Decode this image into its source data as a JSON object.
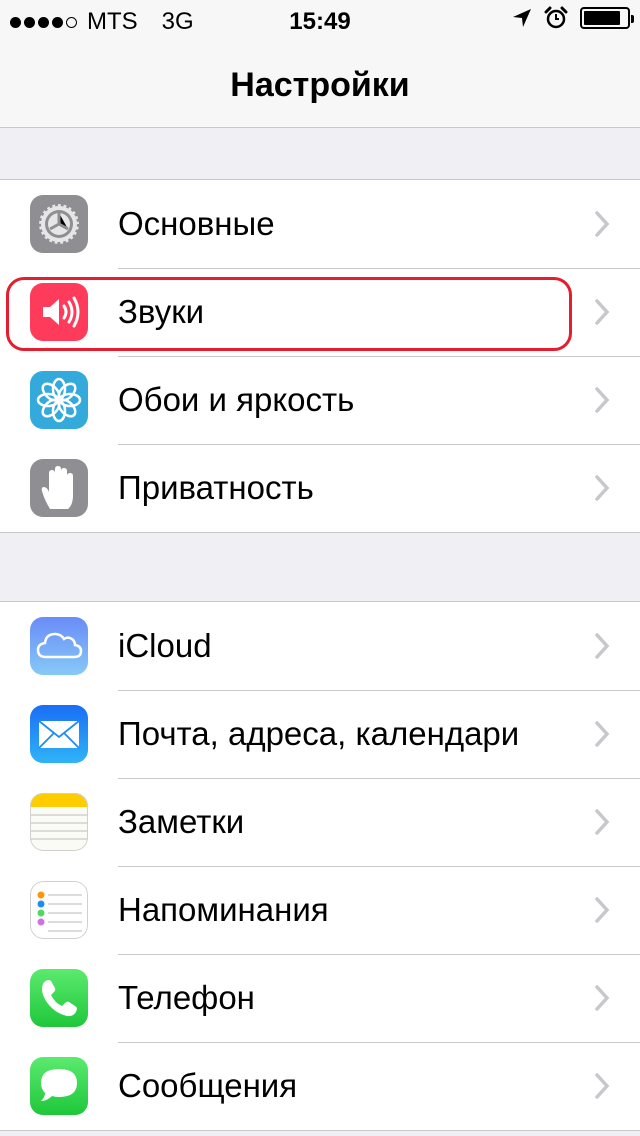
{
  "status_bar": {
    "carrier": "MTS",
    "network": "3G",
    "time": "15:49",
    "signal_bars": 4,
    "battery_level_pct": 85,
    "icons": [
      "location-arrow-icon",
      "alarm-clock-icon",
      "battery-icon"
    ]
  },
  "nav": {
    "title": "Настройки"
  },
  "groups": [
    {
      "items": [
        {
          "label": "Основные",
          "icon": "gear-icon",
          "color": "#8e8e93"
        },
        {
          "label": "Звуки",
          "icon": "speaker-icon",
          "color": "#ff3b5c",
          "highlighted": true
        },
        {
          "label": "Обои и яркость",
          "icon": "flower-icon",
          "color": "#34aadc"
        },
        {
          "label": "Приватность",
          "icon": "hand-icon",
          "color": "#8e8e93"
        }
      ]
    },
    {
      "items": [
        {
          "label": "iCloud",
          "icon": "cloud-icon",
          "color": "#5a7cf5"
        },
        {
          "label": "Почта, адреса, календари",
          "icon": "envelope-icon",
          "color": "#1e8cf5"
        },
        {
          "label": "Заметки",
          "icon": "notepad-icon",
          "color": "#ffcc00"
        },
        {
          "label": "Напоминания",
          "icon": "checklist-icon",
          "color": "#ffffff"
        },
        {
          "label": "Телефон",
          "icon": "phone-icon",
          "color": "#4cd964"
        },
        {
          "label": "Сообщения",
          "icon": "speech-bubble-icon",
          "color": "#4cd964"
        }
      ]
    }
  ],
  "highlight_color": "#e51d2e"
}
